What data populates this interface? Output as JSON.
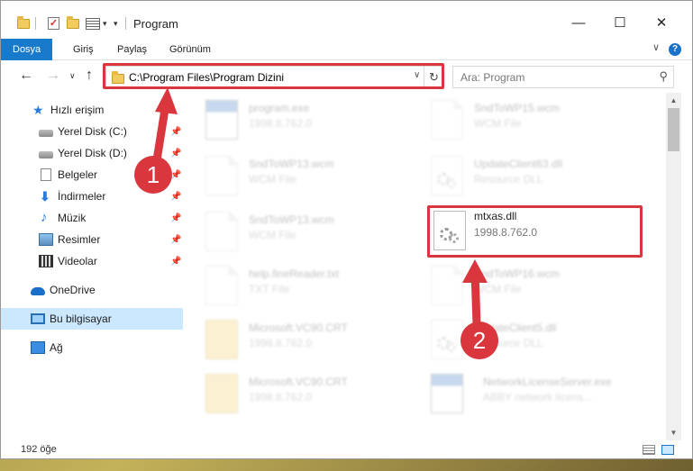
{
  "window": {
    "title": "Program",
    "minimize": "—",
    "maximize": "☐",
    "close": "✕"
  },
  "ribbon": {
    "tabs": [
      "Dosya",
      "Giriş",
      "Paylaş",
      "Görünüm"
    ],
    "help": "?",
    "collapse": "∨"
  },
  "nav": {
    "back": "←",
    "forward": "→",
    "history": "∨",
    "up": "↑",
    "address": "C:\\Program Files\\Program Dizini",
    "address_dropdown": "∨",
    "refresh": "↻",
    "search_placeholder": "Ara: Program",
    "search_icon": "⚲"
  },
  "sidebar": {
    "items": [
      {
        "label": "Hızlı erişim",
        "icon": "star-icon",
        "pinned": false
      },
      {
        "label": "Yerel Disk (C:)",
        "icon": "disk-icon",
        "pinned": true
      },
      {
        "label": "Yerel Disk (D:)",
        "icon": "disk-icon",
        "pinned": true
      },
      {
        "label": "Belgeler",
        "icon": "documents-icon",
        "pinned": true
      },
      {
        "label": "İndirmeler",
        "icon": "download-icon",
        "pinned": true
      },
      {
        "label": "Müzik",
        "icon": "music-icon",
        "pinned": true
      },
      {
        "label": "Resimler",
        "icon": "pictures-icon",
        "pinned": true
      },
      {
        "label": "Videolar",
        "icon": "videos-icon",
        "pinned": true
      },
      {
        "label": "OneDrive",
        "icon": "cloud-icon",
        "pinned": false
      },
      {
        "label": "Bu bilgisayar",
        "icon": "computer-icon",
        "pinned": false,
        "selected": true
      },
      {
        "label": "Ağ",
        "icon": "network-icon",
        "pinned": false
      }
    ],
    "pin_glyph": "📌"
  },
  "files": {
    "left_column": [
      {
        "name": "program.exe",
        "sub": "1998.8.762.0",
        "type": "exe"
      },
      {
        "name": "SndToWP13.wcm",
        "sub": "WCM File",
        "type": "blank"
      },
      {
        "name": "SndToWP13.wcm",
        "sub": "WCM File",
        "type": "blank"
      },
      {
        "name": "help.fineReader.txt",
        "sub": "TXT File",
        "type": "blank"
      },
      {
        "name": "Microsoft.VC90.CRT",
        "sub": "1998.8.762.0",
        "type": "folder"
      },
      {
        "name": "Microsoft.VC90.CRT",
        "sub": "1998.8.762.0",
        "type": "folder"
      }
    ],
    "right_column": [
      {
        "name": "SndToWP15.wcm",
        "sub": "WCM File",
        "type": "blank"
      },
      {
        "name": "UpdateClient63.dll",
        "sub": "Resource DLL",
        "type": "dll"
      },
      {
        "name": "mtxas.dll",
        "sub": "1998.8.762.0",
        "type": "dll",
        "highlighted": true
      },
      {
        "name": "SndToWP16.wcm",
        "sub": "WCM File",
        "type": "blank"
      },
      {
        "name": "UpdateClient5.dll",
        "sub": "Resource DLL",
        "type": "dll"
      },
      {
        "name": "NetworkLicenseServer.exe",
        "sub": "ABBY network licens...",
        "type": "exe"
      }
    ]
  },
  "status": {
    "item_count": "192 öğe"
  },
  "callouts": {
    "step1": "1",
    "step2": "2",
    "color": "#d9363e"
  }
}
